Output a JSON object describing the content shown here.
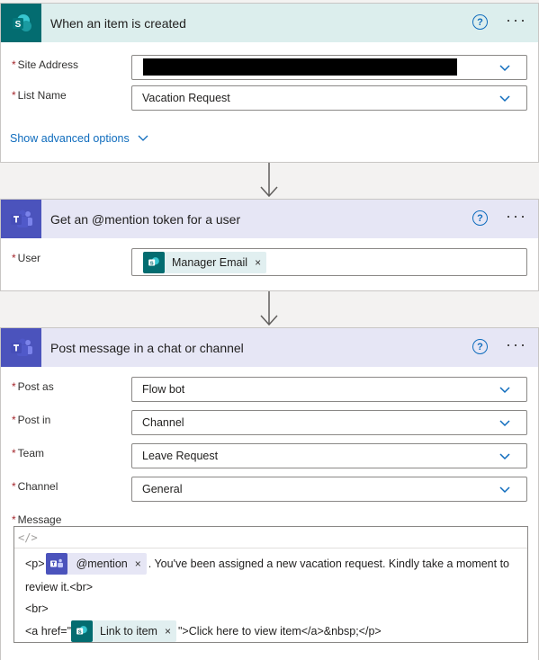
{
  "trigger": {
    "title": "When an item is created",
    "help_glyph": "?",
    "more_glyph": "···",
    "app_letter": "S",
    "site_address": {
      "label": "Site Address",
      "value": ""
    },
    "list_name": {
      "label": "List Name",
      "value": "Vacation Request"
    },
    "advanced_link": "Show advanced options"
  },
  "mention_action": {
    "title": "Get an @mention token for a user",
    "help_glyph": "?",
    "more_glyph": "···",
    "user": {
      "label": "User",
      "token": "Manager Email",
      "token_close": "×"
    }
  },
  "post_action": {
    "title": "Post message in a chat or channel",
    "help_glyph": "?",
    "more_glyph": "···",
    "post_as": {
      "label": "Post as",
      "value": "Flow bot"
    },
    "post_in": {
      "label": "Post in",
      "value": "Channel"
    },
    "team": {
      "label": "Team",
      "value": "Leave Request"
    },
    "channel": {
      "label": "Channel",
      "value": "General"
    },
    "message": {
      "label": "Message",
      "toolbar_glyph": "</>",
      "line1_prefix": "<p>",
      "mention_token": "@mention",
      "line1_suffix": ". You've been assigned a new vacation request. Kindly take a moment to",
      "line2": "review it.<br>",
      "line3": "<br>",
      "line4_prefix": "<a href=\"",
      "link_token": "Link to item",
      "line4_suffix": "\">Click here to view item</a>&nbsp;</p>",
      "token_close": "×"
    }
  },
  "required_marker": "*",
  "colors": {
    "sharepoint": "#036c70",
    "teams": "#4b53bc",
    "link": "#0f6cbd",
    "required": "#a4262c"
  }
}
